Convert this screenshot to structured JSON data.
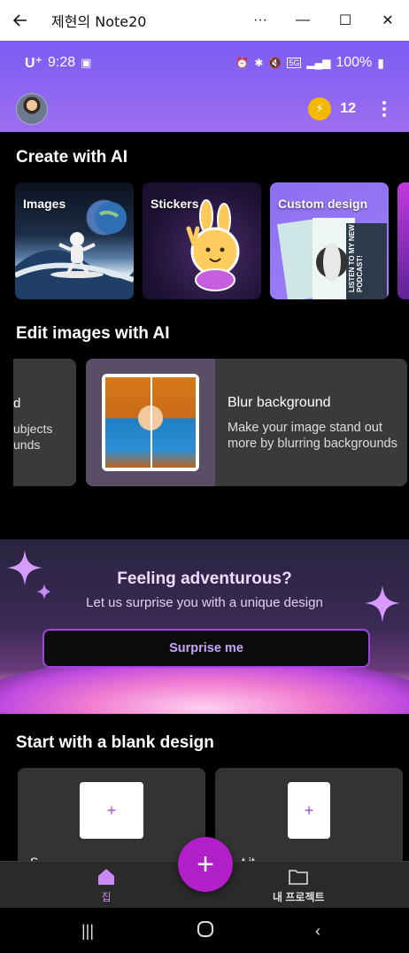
{
  "window": {
    "title": "제현의 Note20",
    "back_icon": "arrow-left-icon",
    "more_label": "···",
    "minimize_label": "—",
    "maximize_label": "☐",
    "close_label": "✕"
  },
  "status_bar": {
    "carrier": "U⁺",
    "time": "9:28",
    "network": "5G",
    "battery": "100%"
  },
  "app_bar": {
    "credits": "12",
    "coin_icon": "lightning-icon"
  },
  "create_ai": {
    "title": "Create with AI",
    "cards": [
      {
        "label": "Images"
      },
      {
        "label": "Stickers"
      },
      {
        "label": "Custom design"
      }
    ],
    "custom_poster_text": "LISTEN TO MY NEW PODCAST!"
  },
  "edit_ai": {
    "title": "Edit images with AI",
    "partial_card": {
      "title": "d",
      "desc_line1": "ubjects",
      "desc_line2": "unds"
    },
    "card": {
      "title": "Blur background",
      "desc": "Make your image stand out more by blurring backgrounds"
    }
  },
  "banner": {
    "title": "Feeling adventurous?",
    "subtitle": "Let us surprise you with a unique design",
    "button": "Surprise me"
  },
  "blank": {
    "title": "Start with a blank design",
    "cards": [
      {
        "label": "S"
      },
      {
        "label": "t it"
      }
    ]
  },
  "bottom_nav": {
    "home": "집",
    "projects": "내 프로젝트",
    "fab": "+",
    "accent": "#b11fc9"
  },
  "colors": {
    "header_start": "#7b5cf3",
    "header_end": "#9d6ef0",
    "accent_purple": "#a244e0"
  }
}
